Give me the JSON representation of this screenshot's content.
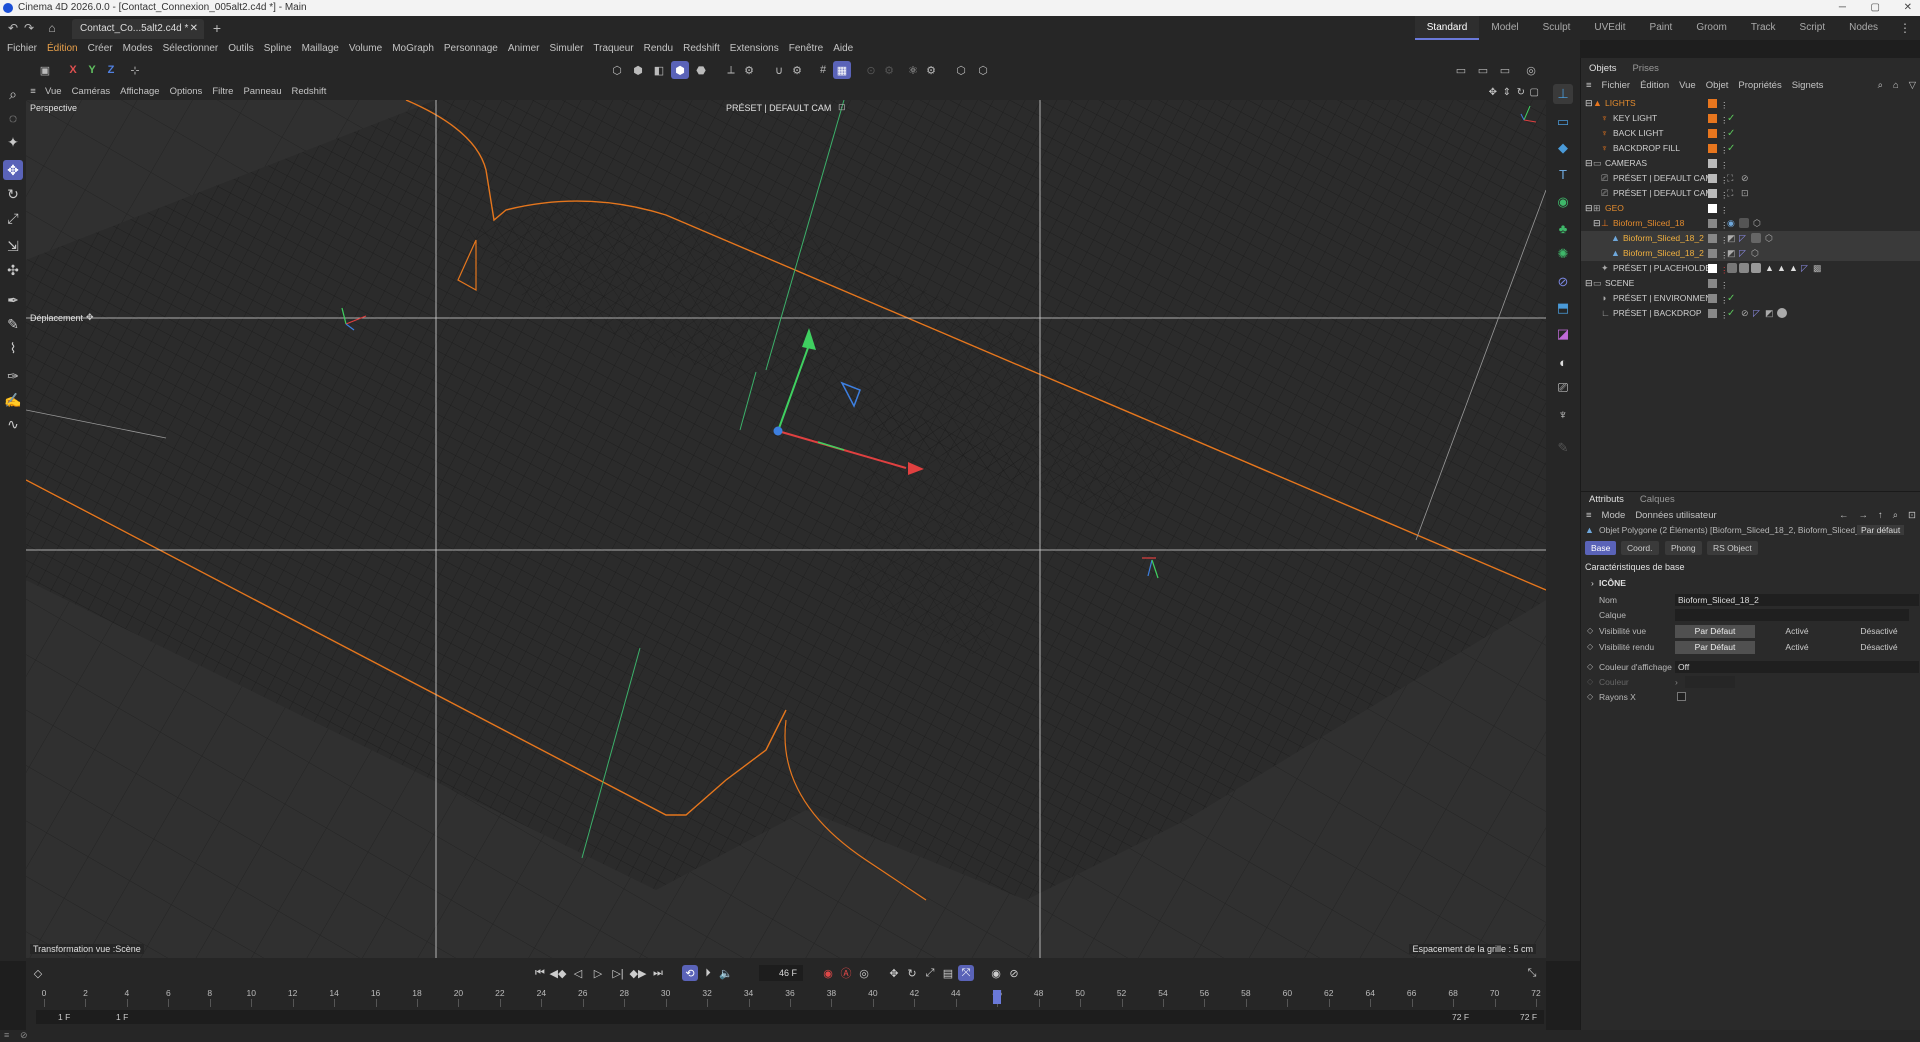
{
  "window": {
    "title": "Cinema 4D 2026.0.0 - [Contact_Connexion_005alt2.c4d *] - Main",
    "controls": [
      "─",
      "▢",
      "✕"
    ]
  },
  "tabs": {
    "document": "Contact_Co...5alt2.c4d *",
    "close": "✕",
    "new": "+",
    "layouts": [
      "Standard",
      "Model",
      "Sculpt",
      "UVEdit",
      "Paint",
      "Groom",
      "Track",
      "Script",
      "Nodes"
    ]
  },
  "menu": [
    "Fichier",
    "Édition",
    "Créer",
    "Modes",
    "Sélectionner",
    "Outils",
    "Spline",
    "Maillage",
    "Volume",
    "MoGraph",
    "Personnage",
    "Animer",
    "Simuler",
    "Traqueur",
    "Rendu",
    "Redshift",
    "Extensions",
    "Fenêtre",
    "Aide"
  ],
  "toolbar": {
    "axis_x": "X",
    "axis_y": "Y",
    "axis_z": "Z"
  },
  "viewport": {
    "menu": [
      "Vue",
      "Caméras",
      "Affichage",
      "Options",
      "Filtre",
      "Panneau",
      "Redshift"
    ],
    "projection": "Perspective",
    "camera": "PRÉSET | DEFAULT CAM",
    "tool_label": "Déplacement",
    "status_left": "Transformation vue :Scène",
    "status_right": "Espacement de la grille : 5 cm"
  },
  "timeline": {
    "current_frame": "46 F",
    "current_value": 46,
    "ticks": [
      "0",
      "2",
      "4",
      "6",
      "8",
      "10",
      "12",
      "14",
      "16",
      "18",
      "20",
      "22",
      "24",
      "26",
      "28",
      "30",
      "32",
      "34",
      "36",
      "38",
      "40",
      "42",
      "44",
      "46",
      "48",
      "50",
      "52",
      "54",
      "56",
      "58",
      "60",
      "62",
      "64",
      "66",
      "68",
      "70",
      "72"
    ],
    "start_a": "1 F",
    "start_b": "1 F",
    "end_a": "72 F",
    "end_b": "72 F"
  },
  "objects_panel": {
    "tabs": [
      "Objets",
      "Prises"
    ],
    "menu": [
      "Fichier",
      "Édition",
      "Vue",
      "Objet",
      "Propriétés",
      "Signets"
    ],
    "items": [
      {
        "name": "LIGHTS",
        "color": "#e8761e",
        "check": "",
        "style": "orange"
      },
      {
        "name": "KEY LIGHT",
        "color": "#e8761e",
        "check": "✓",
        "style": "plain"
      },
      {
        "name": "BACK LIGHT",
        "color": "#e8761e",
        "check": "✓",
        "style": "plain"
      },
      {
        "name": "BACKDROP FILL",
        "color": "#e8761e",
        "check": "✓",
        "style": "plain"
      },
      {
        "name": "CAMERAS",
        "color": "#bbbbbb",
        "check": "",
        "style": "plain"
      },
      {
        "name": "PRÉSET | DEFAULT CAM",
        "color": "#bbbbbb",
        "check": "",
        "style": "plain"
      },
      {
        "name": "PRÉSET | DEFAULT CAM",
        "color": "#bbbbbb",
        "check": "",
        "style": "plain"
      },
      {
        "name": "GEO",
        "color": "#ffffff",
        "check": "",
        "style": "orange"
      },
      {
        "name": "Bioform_Sliced_18",
        "color": "#888888",
        "check": "",
        "style": "orange"
      },
      {
        "name": "Bioform_Sliced_18_2",
        "color": "#888888",
        "check": "",
        "style": "yellow"
      },
      {
        "name": "Bioform_Sliced_18_2",
        "color": "#888888",
        "check": "",
        "style": "yellow"
      },
      {
        "name": "PRÉSET | PLACEHOLDER",
        "color": "#ffffff",
        "check": "",
        "style": "plain"
      },
      {
        "name": "SCENE",
        "color": "#888888",
        "check": "",
        "style": "plain"
      },
      {
        "name": "PRÉSET | ENVIRONMEN",
        "color": "#888888",
        "check": "✓",
        "style": "plain"
      },
      {
        "name": "PRÉSET | BACKDROP",
        "color": "#888888",
        "check": "✓",
        "style": "plain"
      }
    ]
  },
  "attributes_panel": {
    "tabs": [
      "Attributs",
      "Calques"
    ],
    "menu": [
      "Mode",
      "Données utilisateur"
    ],
    "object_title": "Objet Polygone (2 Éléments) [Bioform_Sliced_18_2, Bioform_Sliced_...",
    "preset": "Par défaut",
    "subtabs": [
      "Base",
      "Coord.",
      "Phong",
      "RS Object"
    ],
    "section": "Caractéristiques de base",
    "icon_group": "ICÔNE",
    "fields": {
      "name_label": "Nom",
      "name_value": "Bioform_Sliced_18_2",
      "layer_label": "Calque",
      "visibility_view": "Visibilité vue",
      "visibility_render": "Visibilité rendu",
      "display_color": "Couleur d'affichage",
      "display_color_value": "Off",
      "color": "Couleur",
      "xray": "Rayons X"
    },
    "options": [
      "Par Défaut",
      "Activé",
      "Désactivé"
    ]
  }
}
